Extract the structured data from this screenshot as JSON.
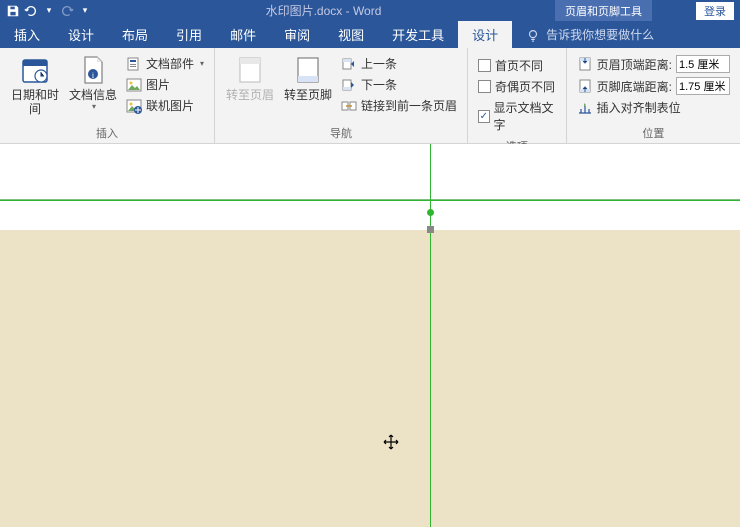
{
  "title_bar": {
    "doc_name": "水印图片.docx - Word",
    "contextual_tab": "页眉和页脚工具",
    "login": "登录"
  },
  "menu": {
    "insert": "插入",
    "design_top": "设计",
    "layout": "布局",
    "references": "引用",
    "mailings": "邮件",
    "review": "审阅",
    "view": "视图",
    "developer": "开发工具",
    "design": "设计",
    "tell_me": "告诉我你想要做什么"
  },
  "ribbon": {
    "insert_group": {
      "label": "插入",
      "date_time": "日期和时间",
      "doc_info": "文档信息",
      "quick_parts": "文档部件",
      "picture": "图片",
      "online_picture": "联机图片"
    },
    "nav_group": {
      "label": "导航",
      "goto_header": "转至页眉",
      "goto_footer": "转至页脚",
      "previous": "上一条",
      "next": "下一条",
      "link_prev": "链接到前一条页眉"
    },
    "options_group": {
      "label": "选项",
      "diff_first": "首页不同",
      "diff_odd_even": "奇偶页不同",
      "show_doc_text": "显示文档文字",
      "diff_first_checked": false,
      "diff_odd_even_checked": false,
      "show_doc_text_checked": true
    },
    "position_group": {
      "label": "位置",
      "header_top": "页眉顶端距离:",
      "header_top_value": "1.5 厘米",
      "footer_bottom": "页脚底端距离:",
      "footer_bottom_value": "1.75 厘米",
      "align_tab": "插入对齐制表位"
    }
  }
}
